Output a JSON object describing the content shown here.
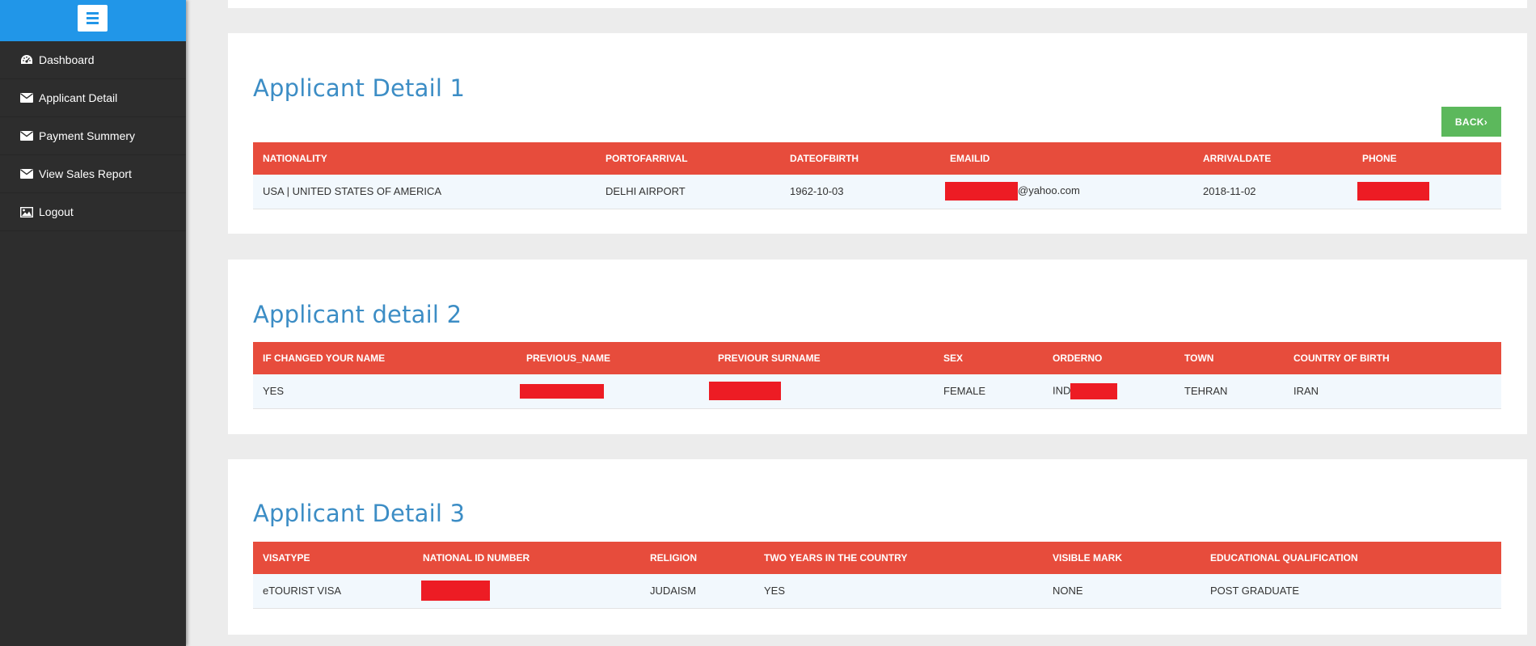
{
  "sidebar": {
    "items": [
      {
        "label": "Dashboard",
        "icon": "dashboard-icon"
      },
      {
        "label": "Applicant Detail",
        "icon": "envelope-icon"
      },
      {
        "label": "Payment Summery",
        "icon": "envelope-icon"
      },
      {
        "label": "View Sales Report",
        "icon": "envelope-icon"
      },
      {
        "label": "Logout",
        "icon": "picture-icon"
      }
    ]
  },
  "colors": {
    "sidebar_top": "#2196e8",
    "sidebar_bg": "#2d2d2d",
    "table_header": "#e74c3c",
    "title": "#3c8dc5",
    "back_button": "#5cb85c",
    "redaction": "#ed1c24"
  },
  "panel1": {
    "title": "Applicant Detail 1",
    "back_label": "BACK›",
    "headers": [
      "NATIONALITY",
      "PORTOFARRIVAL",
      "DATEOFBIRTH",
      "EMAILID",
      "ARRIVALDATE",
      "PHONE"
    ],
    "row": {
      "nationality": "USA | UNITED STATES OF AMERICA",
      "port_of_arrival": "DELHI AIRPORT",
      "date_of_birth": "1962-10-03",
      "email_suffix": "@yahoo.com",
      "arrival_date": "2018-11-02"
    }
  },
  "panel2": {
    "title": "Applicant detail 2",
    "headers": [
      "IF CHANGED YOUR NAME",
      "PREVIOUS_NAME",
      "PREVIOUR SURNAME",
      "SEX",
      "ORDERNO",
      "TOWN",
      "COUNTRY OF BIRTH"
    ],
    "row": {
      "changed_name": "YES",
      "sex": "FEMALE",
      "order_prefix": "IND",
      "town": "TEHRAN",
      "country_of_birth": "IRAN"
    }
  },
  "panel3": {
    "title": "Applicant Detail 3",
    "headers": [
      "VISATYPE",
      "NATIONAL ID NUMBER",
      "RELIGION",
      "TWO YEARS IN THE COUNTRY",
      "VISIBLE MARK",
      "EDUCATIONAL QUALIFICATION"
    ],
    "row": {
      "visa_type": "eTOURIST VISA",
      "religion": "JUDAISM",
      "two_years": "YES",
      "visible_mark": "NONE",
      "education": "POST GRADUATE"
    }
  }
}
